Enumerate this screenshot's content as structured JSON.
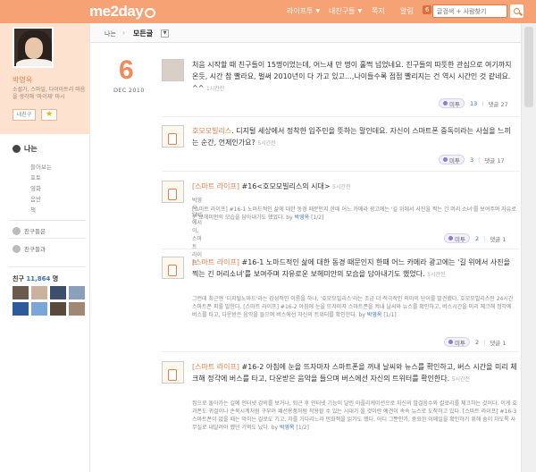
{
  "header": {
    "logo": "me2day",
    "nav": [
      "라이프투",
      "내친구들",
      "쪽지"
    ],
    "alarm_label": "알림",
    "alarm_count": "6",
    "search_placeholder": "글검색 + 사람찾기"
  },
  "profile": {
    "name": "박영옥",
    "bio": "소셜가, 스마일, 다이아트리 마음을 생각해 '마이재' 마시",
    "button_label": "내친구",
    "star_icon": "star-icon"
  },
  "sidebar": {
    "me_label": "나는",
    "sub_items": [
      "들어보는",
      "포토",
      "영화",
      "음반",
      "책"
    ],
    "friends_says": "친구들은",
    "friends_and": "친구들과",
    "friends_count_label": "친구",
    "friends_count": "11,864",
    "friends_count_unit": "명"
  },
  "breadcrumb": {
    "first": "나는",
    "second": "모든글"
  },
  "date": {
    "day": "6",
    "month_year": "DEC 2010"
  },
  "posts": [
    {
      "text": "처음 시작할 때 친구들이 15명이었는데, 어느새 만 명이 훌쩍 넘었네요. 친구들의 따뜻한 관심으로 여기까지 온듯, 시간 참 빨라요, 벌써 2010년이 다 가고 있고…,나이들수록 점점 빨리지는 건 역시 시간인 것 같네요. ^^",
      "time": "1시간전",
      "mitu": "미투",
      "mitu_count": "13",
      "comments": "댓글 27"
    },
    {
      "author": "호모모빌리스",
      "text": ". 디지털 세상에서 정착한 입주민을 뜻하는 말인데요. 자신이 스마트폰 중독이라는 사실을 느끼는 순간, 언제인가요?",
      "time": "5시간전",
      "mitu": "미투",
      "mitu_count": "3",
      "comments": "댓글 17"
    },
    {
      "title": "[스마트 라이프]",
      "text": "#16<호모모빌리스의 시대>",
      "time": "5시간전",
      "meta": "박영옥, SNS에서이, 스마트 라이프",
      "body": "[스마트 라이프] #16-1 노마드적인 삶에 대한 동경 때문인지 한때 어느 카메라 광고에는 '길 위에서 사진을 찍는 긴 머리 소녀'를 보여주며 자유로운 보헤미안의 모습을 담아내기도 했었다. by",
      "by": "박영옥",
      "page": "[1/2]",
      "mitu": "미투",
      "mitu_count": "2",
      "comments": "댓글 1"
    },
    {
      "title": "[스마트 라이프]",
      "text": "#16-1 노마드적인 삶에 대한 동경 때문인지 한때 어느 카메라 광고에는 '길 위에서 사진을 찍는 긴 머리소녀'를 보여주며 자유로운 보헤미안의 모습을 담아내기도 했었다.",
      "time": "5시간전",
      "body": "그런데 최근엔 '디지털노마드'라는 감성적인 이름을 하나, '호모모빌리스'라는 조금 더 적극적인 의미의 단어를 발견했다. 호모모빌리스란 24시간 스마트폰 피를 말한다. [스마트 라이프] #16-2 아침에 눈을 뜨자마자 스마트폰을 켜내 날씨와 뉴스를 확인하고, 버스시간을 미리 체크해 정각에 버스를 타고, 다운받은 음악을 들으며 버스에선 자신의 트위터를 확인한다. by",
      "by": "박영옥",
      "page": "[1/1]",
      "mitu": "미투",
      "mitu_count": "2",
      "comments": "댓글 1"
    },
    {
      "title": "[스마트 라이프]",
      "text": "#16-2 아침에 눈을 뜨자마자 스마트폰을 꺼내 날씨와 뉴스를 확인하고, 버스 시간을 미리 체크해 정각에 버스를 타고, 다운받은 음악을 들으며 버스에선 자신의 트위터를 확인한다.",
      "time": "5시간전",
      "body": "집으로 돌아가는 길에 인터넷 강의를 보거나, 퇴근 후 인터넷 기능이 달린 아플리케이션으로 자신의 발걸음수와 칼로리를 체크하는 것이다. 이게 효과폰도 귀걸이나 손목시계처럼 구부려 패션용품처럼 착용할 수 있는 시대가 올 것이란 예견이 속속 뉴스로 도착하고 있다. [스마트 라이프] #16-3 스마트폰이 없을 때는 막히는 길로도 기고, 차를 기다리느라 만화책을 읽기도 했다. 어디 그뿐인가, 중요한 이메일을 확인하기 위해 숨이 차도록 사무실로 내달려야 했던 기억도 났다. by",
      "by": "박영옥",
      "page": "[1/2]"
    }
  ],
  "colors": {
    "brand": "#f6a275",
    "accent": "#e67e4a",
    "link": "#3b6fb6"
  }
}
